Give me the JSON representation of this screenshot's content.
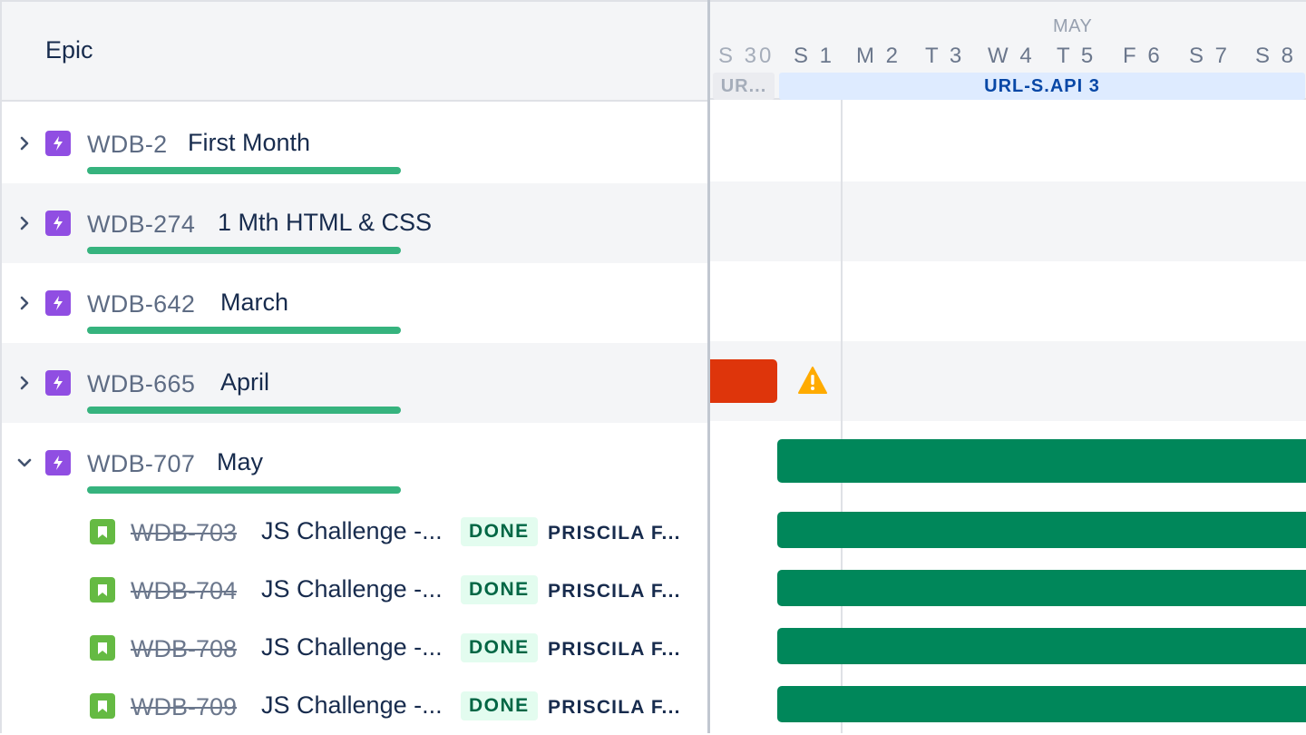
{
  "left_header": {
    "title": "Epic"
  },
  "epics": [
    {
      "key": "WDB-2",
      "summary": "First Month",
      "expanded": false
    },
    {
      "key": "WDB-274",
      "summary": "1 Mth HTML & CSS",
      "expanded": false
    },
    {
      "key": "WDB-642",
      "summary": "March",
      "expanded": false
    },
    {
      "key": "WDB-665",
      "summary": "April",
      "expanded": false
    },
    {
      "key": "WDB-707",
      "summary": "May",
      "expanded": true
    }
  ],
  "stories": [
    {
      "key": "WDB-703",
      "summary": "JS Challenge -...",
      "status": "DONE",
      "assignee": "PRISCILA F..."
    },
    {
      "key": "WDB-704",
      "summary": "JS Challenge -...",
      "status": "DONE",
      "assignee": "PRISCILA F..."
    },
    {
      "key": "WDB-708",
      "summary": "JS Challenge -...",
      "status": "DONE",
      "assignee": "PRISCILA F..."
    },
    {
      "key": "WDB-709",
      "summary": "JS Challenge -...",
      "status": "DONE",
      "assignee": "PRISCILA F..."
    }
  ],
  "timeline": {
    "month": "MAY",
    "days": [
      "S 30",
      "S 1",
      "M 2",
      "T 3",
      "W 4",
      "T 5",
      "F 6",
      "S 7",
      "S 8"
    ],
    "sprints": {
      "past": "UR...",
      "current": "URL-S.API 3"
    }
  },
  "colors": {
    "epic_icon": "#904ee2",
    "story_icon": "#65ba43",
    "progress": "#36b37e",
    "bar_green": "#00875a",
    "bar_red": "#de350b",
    "warning": "#ffab00",
    "done_badge_bg": "#e3fcef",
    "done_badge_text": "#006644"
  },
  "icons": {
    "epic": "lightning-icon",
    "story": "bookmark-icon",
    "expand": "chevron-right-icon",
    "collapse": "chevron-down-icon",
    "warning": "warning-icon"
  }
}
